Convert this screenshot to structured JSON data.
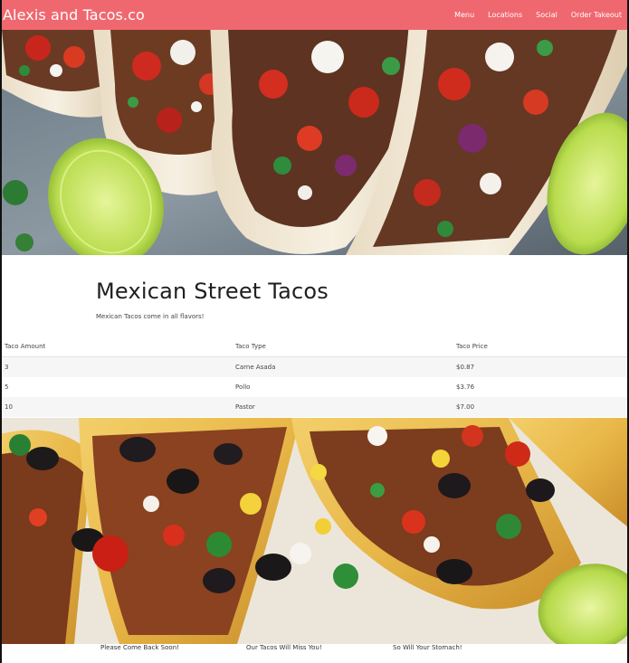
{
  "navbar": {
    "brand": "Alexis and Tacos.co",
    "links": [
      "Menu",
      "Locations",
      "Social",
      "Order Takeout"
    ],
    "color": "#f0686f"
  },
  "hero_top": {
    "icon": "street-tacos-photo"
  },
  "main": {
    "title": "Mexican Street Tacos",
    "subtitle": "Mexican Tacos come in all flavors!"
  },
  "table": {
    "headers": [
      "Taco Amount",
      "Taco Type",
      "Taco Price"
    ],
    "rows": [
      [
        "3",
        "Carne Asada",
        "$0.87"
      ],
      [
        "5",
        "Pollo",
        "$3.76"
      ],
      [
        "10",
        "Pastor",
        "$7.00"
      ]
    ]
  },
  "hero_bottom": {
    "icon": "hard-shell-tacos-photo"
  },
  "footer": {
    "captions": [
      "Please Come Back Soon!",
      "Our Tacos Will Miss You!",
      "So Will Your Stomach!"
    ]
  }
}
